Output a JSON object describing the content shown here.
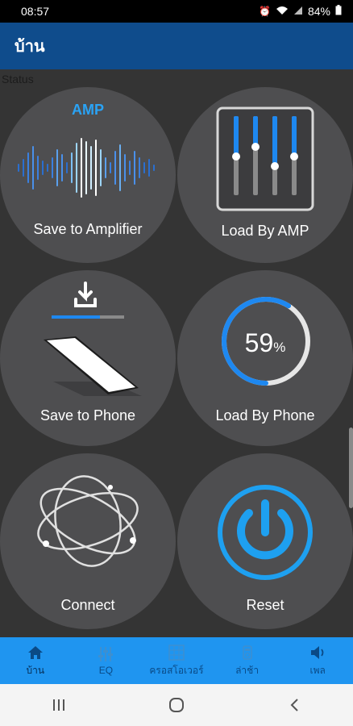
{
  "status_bar": {
    "time": "08:57",
    "battery": "84%"
  },
  "app_bar": {
    "title": "บ้าน"
  },
  "status_label": "Status",
  "tiles": [
    {
      "label": "Save to Amplifier",
      "badge": "AMP",
      "icon": "waveform-icon"
    },
    {
      "label": "Load By AMP",
      "icon": "equalizer-sliders-icon"
    },
    {
      "label": "Save to Phone",
      "icon": "download-phone-icon"
    },
    {
      "label": "Load By Phone",
      "percent_value": "59",
      "percent_sign": "%",
      "progress": 0.59,
      "icon": "progress-ring-icon"
    },
    {
      "label": "Connect",
      "icon": "orbit-icon"
    },
    {
      "label": "Reset",
      "icon": "power-icon"
    }
  ],
  "bottom_nav": [
    {
      "label": "บ้าน",
      "icon": "home-icon",
      "active": true
    },
    {
      "label": "EQ",
      "icon": "eq-icon",
      "active": false
    },
    {
      "label": "ครอสโอเวอร์",
      "icon": "crossover-icon",
      "active": false
    },
    {
      "label": "ล่าช้า",
      "icon": "delay-icon",
      "active": false
    },
    {
      "label": "เพล",
      "icon": "speaker-icon",
      "active": false
    }
  ],
  "colors": {
    "app_bar": "#0f4c8c",
    "accent": "#1f95f0",
    "tile": "#4e4e50",
    "background": "#343434"
  }
}
